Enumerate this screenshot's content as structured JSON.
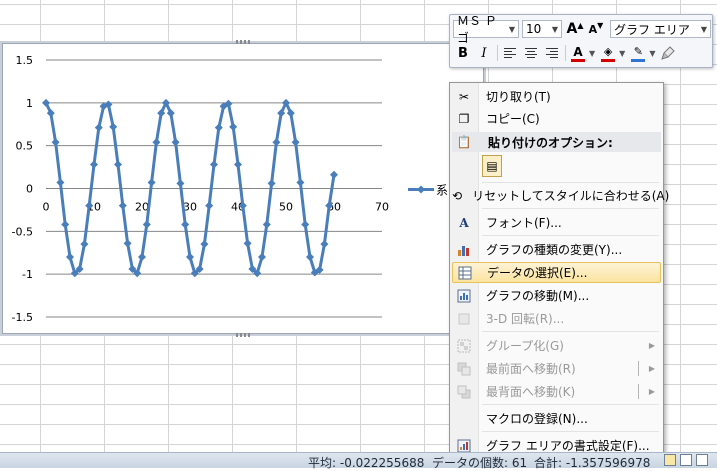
{
  "mini_toolbar": {
    "font_name": "ＭＳ Ｐゴ",
    "font_size": "10",
    "grow_font_glyph": "A",
    "shrink_font_glyph": "A",
    "element_selector": "グラフ エリア",
    "bold": "B",
    "italic": "I",
    "font_color_glyph": "A",
    "font_color": "#d40000",
    "fill_color": "#d40000",
    "outline_color": "#2e75d6"
  },
  "context_menu": {
    "items": [
      {
        "label": "切り取り(T)",
        "icon": "scissors-icon"
      },
      {
        "label": "コピー(C)",
        "icon": "copy-icon"
      },
      {
        "label": "貼り付けのオプション:",
        "icon": "paste-icon"
      },
      {
        "label": "リセットしてスタイルに合わせる(A)",
        "icon": "reset-style-icon"
      },
      {
        "label": "フォント(F)...",
        "icon": "font-icon"
      },
      {
        "label": "グラフの種類の変更(Y)...",
        "icon": "chart-type-icon"
      },
      {
        "label": "データの選択(E)...",
        "icon": "select-data-icon"
      },
      {
        "label": "グラフの移動(M)...",
        "icon": "move-chart-icon"
      },
      {
        "label": "3-D 回転(R)...",
        "icon": "rotate-3d-icon"
      },
      {
        "label": "グループ化(G)",
        "icon": "group-icon"
      },
      {
        "label": "最前面へ移動(R)",
        "icon": "bring-front-icon"
      },
      {
        "label": "最背面へ移動(K)",
        "icon": "send-back-icon"
      },
      {
        "label": "マクロの登録(N)...",
        "icon": "macro-icon"
      },
      {
        "label": "グラフ エリアの書式設定(F)...",
        "icon": "format-chart-area-icon"
      }
    ]
  },
  "status_bar": {
    "average": "平均: -0.022255688",
    "count": "データの個数: 61",
    "sum": "合計: -1.357596978"
  },
  "chart_data": {
    "type": "line",
    "title": "",
    "xlabel": "",
    "ylabel": "",
    "xlim": [
      0,
      70
    ],
    "ylim": [
      -1.5,
      1.5
    ],
    "x_ticks": [
      "0",
      "10",
      "20",
      "30",
      "40",
      "50",
      "60",
      "70"
    ],
    "y_ticks": [
      "1.5",
      "1",
      "0.5",
      "0",
      "-0.5",
      "-1",
      "-1.5"
    ],
    "grid": true,
    "legend": "right",
    "line_color": "#4a7ebb",
    "series": [
      {
        "name": "系",
        "x": [
          0,
          1,
          2,
          3,
          4,
          5,
          6,
          7,
          8,
          9,
          10,
          11,
          12,
          13,
          14,
          15,
          16,
          17,
          18,
          19,
          20,
          21,
          22,
          23,
          24,
          25,
          26,
          27,
          28,
          29,
          30,
          31,
          32,
          33,
          34,
          35,
          36,
          37,
          38,
          39,
          40,
          41,
          42,
          43,
          44,
          45,
          46,
          47,
          48,
          49,
          50,
          51,
          52,
          53,
          54,
          55,
          56,
          57,
          58,
          59,
          60
        ],
        "values": [
          1,
          0.88,
          0.54,
          0.07,
          -0.42,
          -0.8,
          -0.99,
          -0.94,
          -0.65,
          -0.2,
          0.28,
          0.71,
          0.96,
          0.98,
          0.72,
          0.28,
          -0.2,
          -0.64,
          -0.94,
          -0.99,
          -0.8,
          -0.42,
          0.07,
          0.54,
          0.88,
          1,
          0.88,
          0.54,
          0.06,
          -0.42,
          -0.8,
          -0.99,
          -0.94,
          -0.65,
          -0.2,
          0.28,
          0.71,
          0.96,
          0.99,
          0.72,
          0.28,
          -0.2,
          -0.64,
          -0.94,
          -0.99,
          -0.8,
          -0.42,
          0.06,
          0.54,
          0.88,
          1,
          0.88,
          0.54,
          0.07,
          -0.42,
          -0.8,
          -0.98,
          -0.95,
          -0.65,
          -0.2,
          0.16
        ]
      }
    ]
  }
}
